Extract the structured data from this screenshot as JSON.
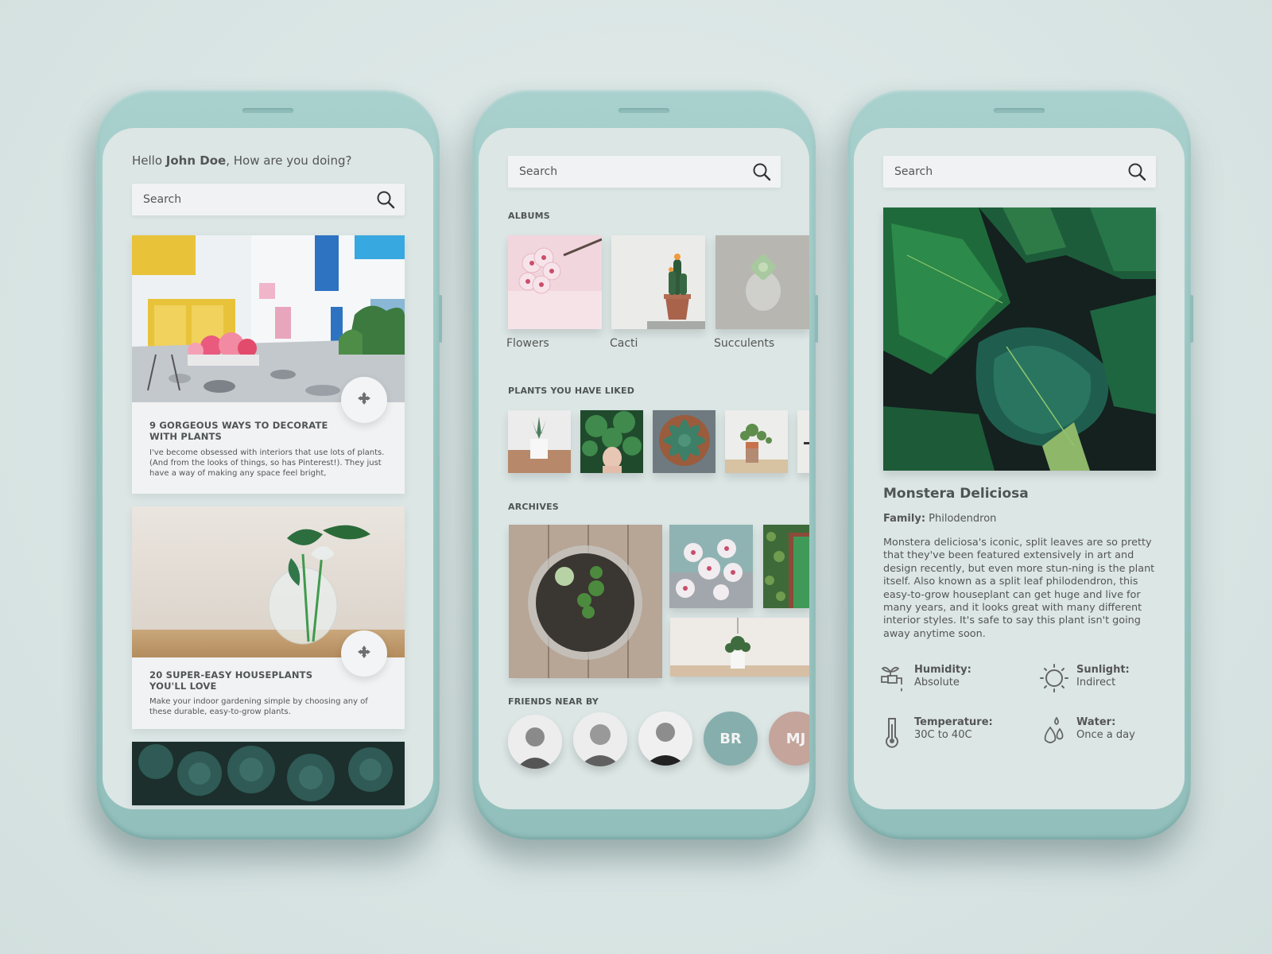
{
  "home_screen": {
    "greeting_prefix": "Hello ",
    "user_name": "John Doe",
    "greeting_suffix": ", How are you doing?",
    "search": {
      "placeholder": "Search"
    },
    "articles": [
      {
        "title": "9 GORGEOUS WAYS TO DECORATE WITH PLANTS",
        "excerpt": "I've become obsessed with interiors that use lots of plants. (And from the looks of things, so has Pinterest!). They just have a way of making any space feel bright,",
        "image": "colorful-street-with-flowers",
        "action_icon": "move-arrows-icon"
      },
      {
        "title": "20 SUPER-EASY HOUSEPLANTS YOU'LL LOVE",
        "excerpt": "Make your indoor gardening simple by choosing any of these durable, easy-to-grow plants.",
        "image": "calla-lily-in-glass-vase",
        "action_icon": "move-arrows-icon"
      },
      {
        "image": "dark-succulents"
      }
    ]
  },
  "explore_screen": {
    "search": {
      "placeholder": "Search"
    },
    "albums": {
      "label": "ALBUMS",
      "items": [
        {
          "name": "Flowers",
          "image": "cherry-blossom"
        },
        {
          "name": "Cacti",
          "image": "cactus-in-pot"
        },
        {
          "name": "Succulents",
          "image": "succulent-in-glass"
        }
      ]
    },
    "liked": {
      "label": "PLANTS YOU HAVE LIKED",
      "items": [
        "aloe-in-white-pot",
        "woman-behind-leaves",
        "succulent-top-view",
        "trailing-plant-in-pot",
        "partial-plant"
      ]
    },
    "archives": {
      "label": "ARCHIVES",
      "items": [
        "terrarium",
        "white-blossoms",
        "ivy-door",
        "hanging-plant"
      ]
    },
    "friends": {
      "label": "FRIENDS NEAR BY",
      "items": [
        {
          "type": "photo",
          "name": "friend-1"
        },
        {
          "type": "photo",
          "name": "friend-2"
        },
        {
          "type": "photo",
          "name": "friend-3"
        },
        {
          "type": "initials",
          "initials": "BR",
          "color": "#86aeac"
        },
        {
          "type": "initials",
          "initials": "MJ",
          "color": "#c4a49b"
        }
      ]
    }
  },
  "detail_screen": {
    "search": {
      "placeholder": "Search"
    },
    "plant": {
      "image": "monstera-leaves",
      "name": "Monstera Deliciosa",
      "family_label": "Family:",
      "family": " Philodendron",
      "description": "Monstera deliciosa's iconic, split leaves are so pretty that they've been featured extensively in art and design recently, but even more stun-ning is the plant itself. Also known as a split leaf philodendron, this easy-to-grow houseplant can get huge and live for many years, and it looks great with many different interior styles. It's safe to say this plant isn't going away anytime soon.",
      "attributes": [
        {
          "label": "Humidity:",
          "value": "Absolute",
          "icon": "faucet-plant-icon"
        },
        {
          "label": "Sunlight:",
          "value": "Indirect",
          "icon": "sun-icon"
        },
        {
          "label": "Temperature:",
          "value": "30C to 40C",
          "icon": "thermometer-icon"
        },
        {
          "label": "Water:",
          "value": "Once a day",
          "icon": "water-drops-icon"
        }
      ]
    }
  },
  "colors": {
    "background": "#dbe6e5",
    "phone_body": "#9ec9c5",
    "text": "#555a5a",
    "card": "#f1f2f3"
  }
}
